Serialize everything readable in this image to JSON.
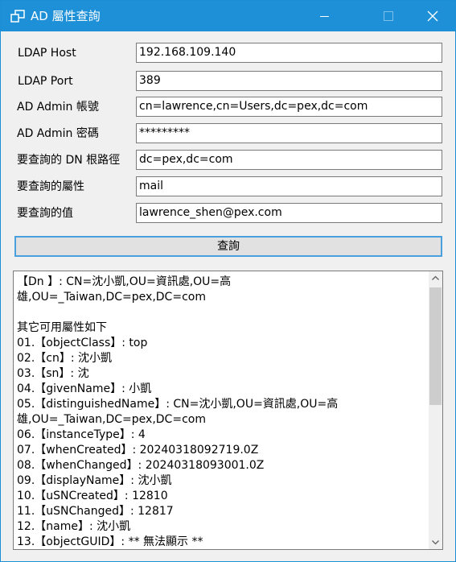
{
  "window": {
    "title": "AD 屬性查詢",
    "icon": "windows-overlap-icon",
    "accent": "#1e90d7"
  },
  "form": {
    "fields": [
      {
        "label": "LDAP Host",
        "value": "192.168.109.140"
      },
      {
        "label": "LDAP Port",
        "value": "389"
      },
      {
        "label": "AD Admin 帳號",
        "value": "cn=lawrence,cn=Users,dc=pex,dc=com"
      },
      {
        "label": "AD Admin 密碼",
        "value": "*********"
      },
      {
        "label": "要查詢的 DN 根路徑",
        "value": "dc=pex,dc=com"
      },
      {
        "label": "要查詢的屬性",
        "value": "mail"
      },
      {
        "label": "要查詢的值",
        "value": "lawrence_shen@pex.com"
      }
    ],
    "query_button_label": "查詢"
  },
  "output": {
    "text": "【Dn 】: CN=沈小凱,OU=資訊處,OU=高\n雄,OU=_Taiwan,DC=pex,DC=com\n\n其它可用屬性如下\n01.【objectClass】: top\n02.【cn】: 沈小凱\n03.【sn】: 沈\n04.【givenName】: 小凱\n05.【distinguishedName】: CN=沈小凱,OU=資訊處,OU=高\n雄,OU=_Taiwan,DC=pex,DC=com\n06.【instanceType】: 4\n07.【whenCreated】: 20240318092719.0Z\n08.【whenChanged】: 20240318093001.0Z\n09.【displayName】: 沈小凱\n10.【uSNCreated】: 12810\n11.【uSNChanged】: 12817\n12.【name】: 沈小凱\n13.【objectGUID】: ** 無法顯示 **"
  }
}
